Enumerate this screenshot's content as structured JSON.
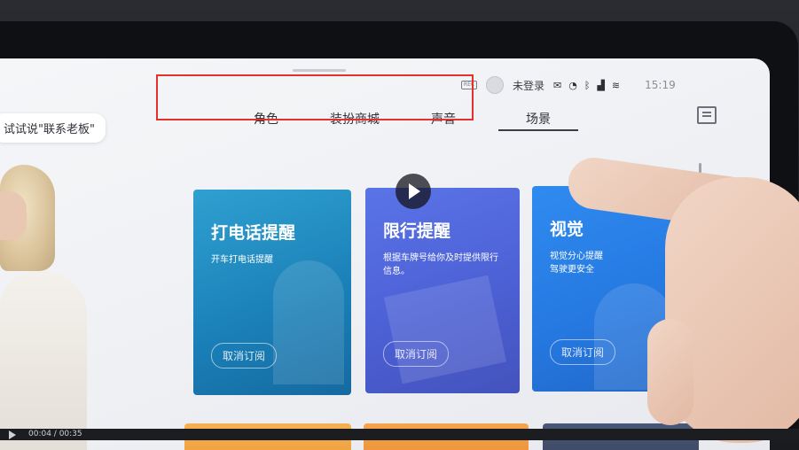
{
  "statusbar": {
    "rec_label": "REC",
    "login_text": "未登录",
    "time": "15:19"
  },
  "hint": {
    "text": "试试说\"联系老板\""
  },
  "tabs": [
    {
      "label": "角色"
    },
    {
      "label": "装扮商城"
    },
    {
      "label": "声音"
    },
    {
      "label": "场景"
    }
  ],
  "cards": [
    {
      "title": "打电话提醒",
      "desc": "开车打电话提醒",
      "button": "取消订阅"
    },
    {
      "title": "限行提醒",
      "desc": "根据车牌号给你及时提供限行信息。",
      "button": "取消订阅"
    },
    {
      "title": "视觉",
      "desc": "视觉分心提醒\n驾驶更安全",
      "button": "取消订阅"
    }
  ],
  "player": {
    "time": "00:04 / 00:35"
  },
  "colors": {
    "highlight": "#e5312b",
    "card1": "#1a7fb7",
    "card2": "#4b5fd3",
    "card3": "#2578e0"
  }
}
